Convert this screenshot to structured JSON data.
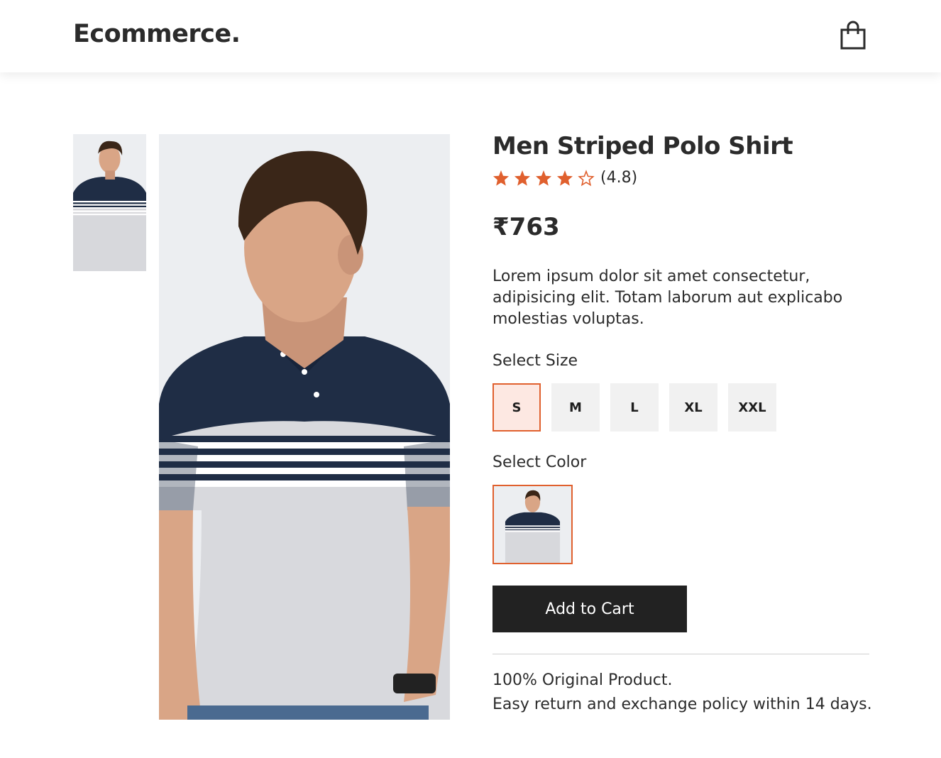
{
  "brand": {
    "logo_text": "Ecommerce."
  },
  "header": {
    "cart_icon": "shopping-bag-icon"
  },
  "product": {
    "title": "Men Striped Polo Shirt",
    "rating": {
      "stars_filled": 4,
      "stars_total": 5,
      "text": "(4.8)"
    },
    "price": "₹763",
    "description": "Lorem ipsum dolor sit amet consectetur, adipisicing elit. Totam laborum aut explicabo molestias voluptas.",
    "size_label": "Select Size",
    "sizes": [
      "S",
      "M",
      "L",
      "XL",
      "XXL"
    ],
    "selected_size": "S",
    "color_label": "Select Color",
    "add_to_cart_label": "Add to Cart",
    "policy_line1": "100% Original Product.",
    "policy_line2": "Easy return and exchange policy within 14 days."
  },
  "colors": {
    "accent": "#e0602e",
    "button_bg": "#222222",
    "size_bg": "#f1f1f1",
    "size_active_bg": "#fde8e2",
    "image_bg": "#eceef1"
  }
}
